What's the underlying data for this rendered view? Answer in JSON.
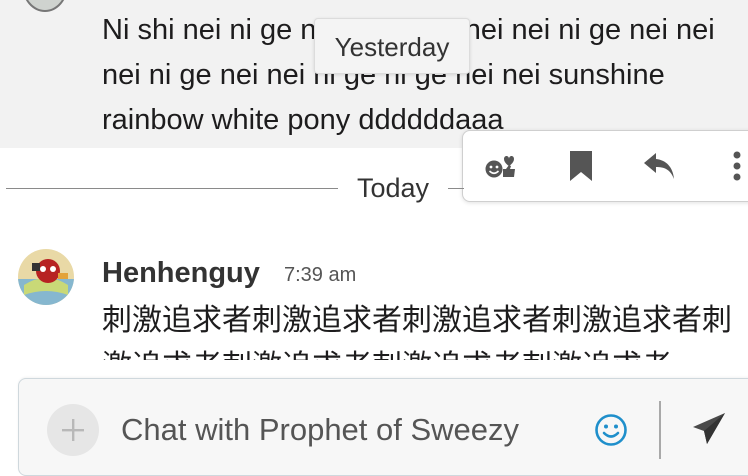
{
  "previous_message": {
    "text": "Ni shi nei ni ge nei nei ni ge nei nei ni ge nei nei nei ni ge nei nei ni ge ni ge nei nei sunshine rainbow white pony ddddddaaa"
  },
  "date_tooltip": "Yesterday",
  "divider": {
    "label": "Today"
  },
  "message": {
    "sender": "Henhenguy",
    "time": "7:39 am",
    "text": "刺激追求者刺激追求者刺激追求者刺激追求者刺激追求者刺激追求者刺激追求者刺激追求者"
  },
  "action_bar": {
    "icons": [
      "add-reaction-icon",
      "bookmark-icon",
      "reply-icon",
      "more-options-icon"
    ]
  },
  "compose": {
    "placeholder": "Chat with Prophet of Sweezy",
    "icons": [
      "plus-icon",
      "emoji-icon",
      "send-icon"
    ]
  },
  "colors": {
    "previous_message_bg": "#f2f2f2",
    "icon_gray": "#555555",
    "emoji_blue": "#1f8fcb"
  }
}
